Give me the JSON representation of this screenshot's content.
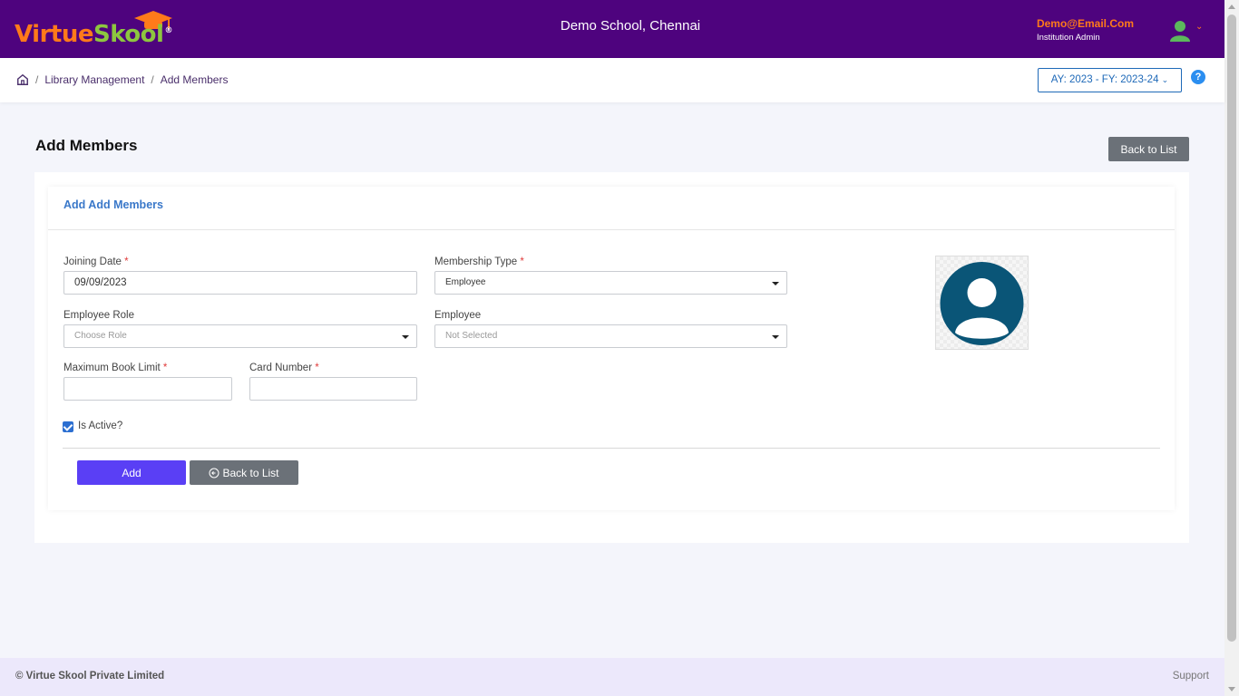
{
  "header": {
    "logo_text_virtue": "Virtue",
    "logo_text_skool": "Skool",
    "logo_reg": "®",
    "school_name": "Demo School, Chennai",
    "user_email": "Demo@Email.Com",
    "user_role": "Institution Admin",
    "colors": {
      "bar": "#4e037e",
      "accent": "#ff7a1a",
      "green": "#8dc63f"
    }
  },
  "breadcrumb": {
    "items": [
      "Library Management",
      "Add Members"
    ],
    "separator": "/"
  },
  "academic_year": "AY: 2023 - FY: 2023-24",
  "help_label": "?",
  "page": {
    "title": "Add Members",
    "back_to_list_top": "Back to List"
  },
  "form": {
    "card_title": "Add Add Members",
    "joining_date": {
      "label": "Joining Date",
      "value": "09/09/2023"
    },
    "membership_type": {
      "label": "Membership Type",
      "value": "Employee"
    },
    "employee_role": {
      "label": "Employee Role",
      "placeholder": "Choose Role"
    },
    "employee": {
      "label": "Employee",
      "placeholder": "Not Selected"
    },
    "max_book_limit": {
      "label": "Maximum Book Limit",
      "value": ""
    },
    "card_number": {
      "label": "Card Number",
      "value": ""
    },
    "is_active": {
      "label": "Is Active?",
      "checked": true
    },
    "required_mark": "*",
    "add_button": "Add",
    "back_button": "Back to List"
  },
  "footer": {
    "copyright": "© Virtue Skool Private Limited",
    "support": "Support"
  }
}
